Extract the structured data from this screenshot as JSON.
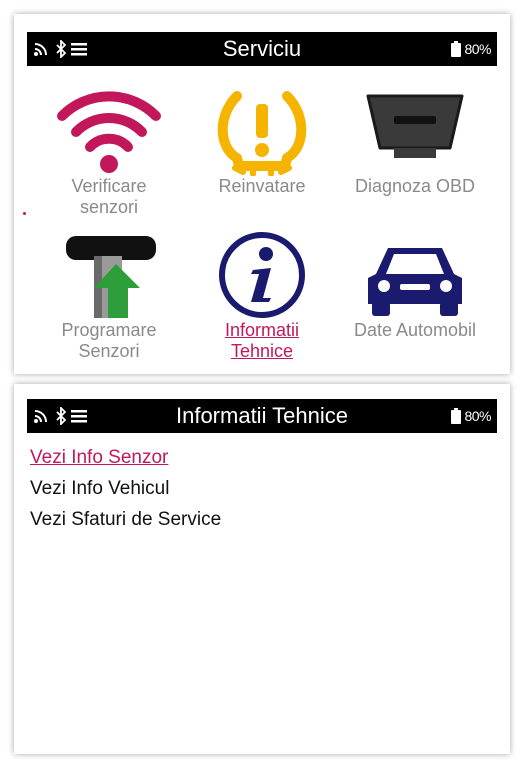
{
  "screen1": {
    "status": {
      "title": "Serviciu",
      "battery": "80%"
    },
    "tiles": [
      {
        "label": "Verificare senzori",
        "icon": "wifi-sensor-icon"
      },
      {
        "label": "Reinvatare",
        "icon": "tpms-warning-icon"
      },
      {
        "label": "Diagnoza OBD",
        "icon": "obd-connector-icon"
      },
      {
        "label": "Programare Senzori",
        "icon": "sensor-programming-icon"
      },
      {
        "label": "Informatii Tehnice",
        "icon": "info-icon",
        "selected": true
      },
      {
        "label": "Date Automobil",
        "icon": "car-icon"
      }
    ]
  },
  "screen2": {
    "status": {
      "title": "Informatii Tehnice",
      "battery": "80%"
    },
    "menu": [
      {
        "label": "Vezi Info Senzor",
        "selected": true
      },
      {
        "label": "Vezi Info Vehicul"
      },
      {
        "label": "Vezi Sfaturi de Service"
      }
    ]
  },
  "colors": {
    "accent": "#c2185b",
    "tpms_yellow": "#f4b400",
    "info_navy": "#1a1a6e",
    "arrow_green": "#2e9e3a",
    "status_bar": "#000000"
  }
}
